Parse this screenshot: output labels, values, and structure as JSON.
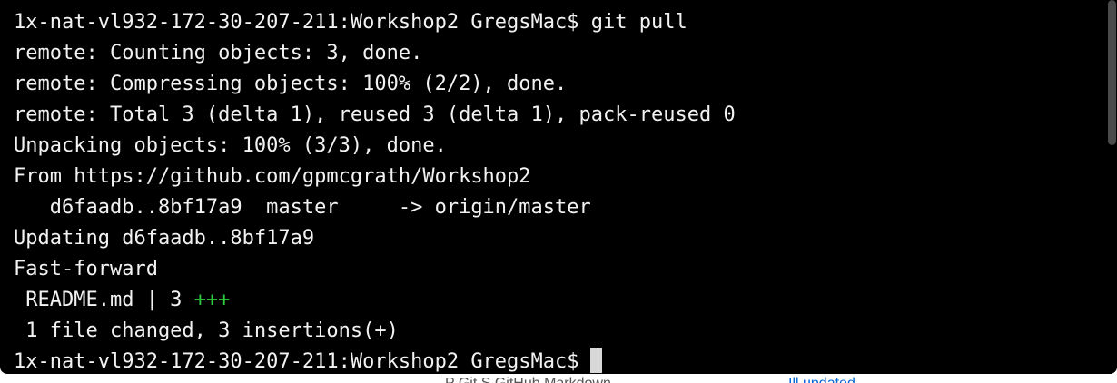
{
  "terminal": {
    "prompt_line": "1x-nat-vl932-172-30-207-211:Workshop2 GregsMac$ git pull",
    "output": [
      "remote: Counting objects: 3, done.",
      "remote: Compressing objects: 100% (2/2), done.",
      "remote: Total 3 (delta 1), reused 3 (delta 1), pack-reused 0",
      "Unpacking objects: 100% (3/3), done.",
      "From https://github.com/gpmcgrath/Workshop2",
      "   d6faadb..8bf17a9  master     -> origin/master",
      "Updating d6faadb..8bf17a9",
      "Fast-forward"
    ],
    "diffstat_file": " README.md | 3 ",
    "diffstat_plus": "+++",
    "summary": " 1 file changed, 3 insertions(+)",
    "current_prompt": "1x-nat-vl932-172-30-207-211:Workshop2 GregsMac$"
  },
  "background_page": {
    "partial_text": "P  Git  S    GitHub Markdown",
    "partial_link": "Ill updated"
  },
  "colors": {
    "terminal_bg": "#000000",
    "terminal_fg": "#f2f2f2",
    "diff_plus": "#2ecc40",
    "cursor": "#d8d8d8"
  }
}
